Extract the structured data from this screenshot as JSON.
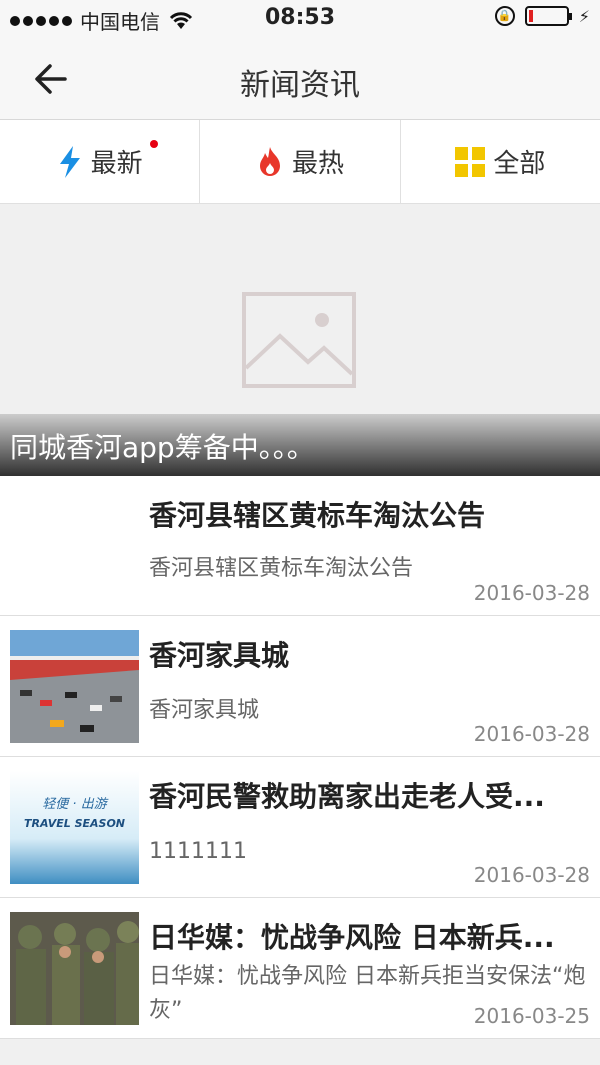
{
  "status_bar": {
    "carrier": "中国电信",
    "time": "08:53"
  },
  "nav": {
    "title": "新闻资讯",
    "back_icon": "arrow-left-icon"
  },
  "tabs": [
    {
      "label": "最新",
      "icon": "lightning-icon",
      "has_dot": true
    },
    {
      "label": "最热",
      "icon": "fire-icon",
      "has_dot": false
    },
    {
      "label": "全部",
      "icon": "grid-icon",
      "has_dot": false
    }
  ],
  "banner": {
    "caption": "同城香河app筹备中。。。"
  },
  "news": [
    {
      "title": "香河县辖区黄标车淘汰公告",
      "summary": "香河县辖区黄标车淘汰公告",
      "date": "2016-03-28"
    },
    {
      "title": "香河家具城",
      "summary": "香河家具城",
      "date": "2016-03-28"
    },
    {
      "title": "香河民警救助离家出走老人受...",
      "summary": "1111111",
      "date": "2016-03-28",
      "thumb_text": [
        "轻便 · 出游",
        "TRAVEL SEASON"
      ]
    },
    {
      "title": "日华媒：忧战争风险 日本新兵...",
      "summary": "日华媒：忧战争风险 日本新兵拒当安保法“炮灰”",
      "date": "2016-03-25"
    }
  ],
  "colors": {
    "accent_blue": "#1a8fe3",
    "fire_red": "#e8372b",
    "grid_yellow": "#f2c600",
    "dot_red": "#e60012"
  }
}
